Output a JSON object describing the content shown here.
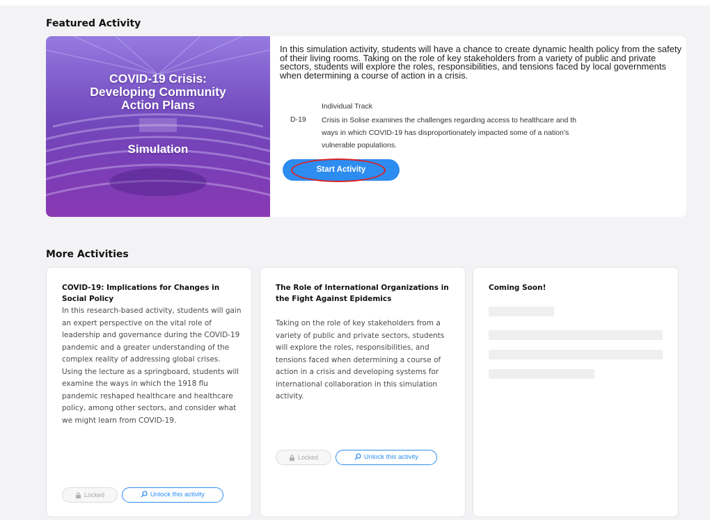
{
  "featured": {
    "section_title": "Featured Activity",
    "image_title": "COVID-19 Crisis:\nDeveloping Community\nAction Plans",
    "image_subtitle": "Simulation",
    "description": "In this simulation activity, students will have a chance to create dynamic health policy from the safety of their living rooms. Taking on the role of key stakeholders from a variety of public and private sectors, students will explore the roles, responsibilities, and tensions faced by local governments when determining a course of action in a crisis.",
    "track_label": "Individual Track",
    "track_code": "D-19",
    "track_description": "Crisis in Solise examines the challenges regarding access to healthcare and th\nways in which COVID-19 has disproportionately impacted some of a nation’s\nvulnerable populations.",
    "start_label": "Start Activity"
  },
  "more": {
    "section_title": "More Activities",
    "cards": [
      {
        "title": "COVID-19: Implications for Changes in Social Policy",
        "description": "In this research-based activity, students will gain an expert perspective on the vital role of leadership and governance during the COVID-19 pandemic and a greater understanding of the complex reality of addressing global crises. Using the lecture as a springboard, students will examine the ways in which the 1918 flu pandemic reshaped healthcare and healthcare policy, among other sectors, and consider what we might learn from COVID-19.",
        "locked_label": "Locked",
        "unlock_label": "Unlock this activity"
      },
      {
        "title": "The Role of International Organizations in the Fight Against Epidemics",
        "description": "Taking on the role of key stakeholders from a variety of public and private sectors, students will explore the roles, responsibilities, and tensions faced when determining a course of action in a crisis and developing systems for international collaboration in this simulation activity.",
        "locked_label": "Locked",
        "unlock_label": "Unlock this activity"
      },
      {
        "title": "Coming Soon!"
      }
    ]
  },
  "colors": {
    "accent": "#2d8cf0",
    "annotation_ring": "#dd2222",
    "image_gradient_top": "#7a5ad0",
    "image_gradient_bottom": "#8a3ab4"
  }
}
